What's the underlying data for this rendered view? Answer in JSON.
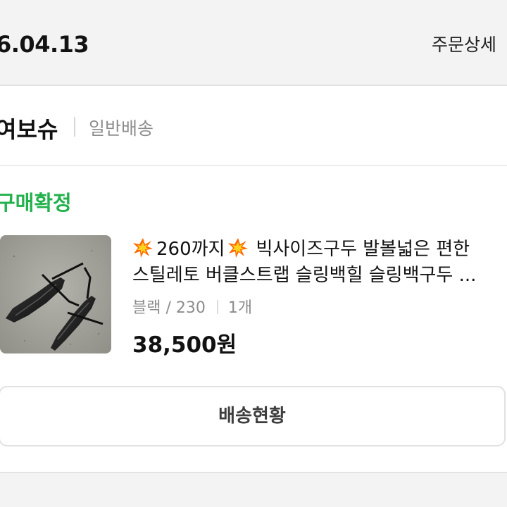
{
  "header": {
    "order_date": "6.04.13",
    "order_detail_label": "주문상세"
  },
  "store": {
    "name": "여보슈",
    "delivery_type": "일반배송"
  },
  "order": {
    "status": "구매확정",
    "status_color": "#22b14c",
    "product": {
      "title_prefix_icon": "collision-emoji-icon",
      "title_size_note": "260까지",
      "title_suffix_icon": "collision-emoji-icon",
      "title_line1_rest": "빅사이즈구두 발볼넓은 편한",
      "title_line2": "스틸레토 버클스트랩 슬링백힐 슬링백구두 ...",
      "option": "블랙 / 230",
      "quantity": "1개",
      "price": "38,500원"
    },
    "track_button_label": "배송현황"
  }
}
